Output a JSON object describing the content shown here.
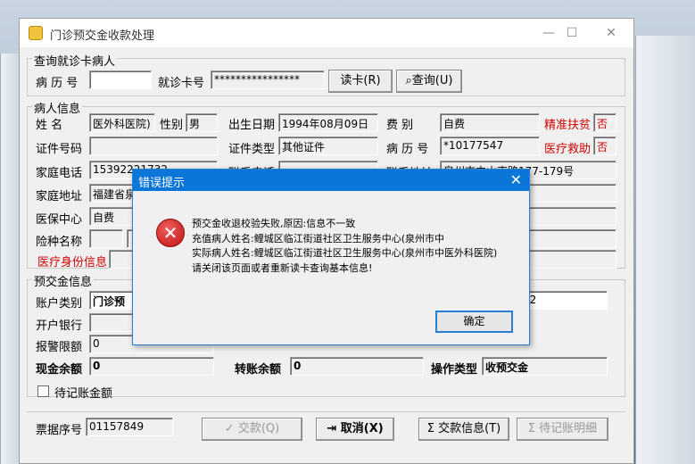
{
  "window": {
    "title": "门诊预交金收款处理"
  },
  "query": {
    "group_label": "查询就诊卡病人",
    "record_label": "病 历 号",
    "record_value": "",
    "card_label": "就诊卡号",
    "card_value": "****************",
    "read_card_button": "读卡(R)",
    "search_button": "查询(U)"
  },
  "patient": {
    "group_label": "病人信息",
    "name_label": "姓    名",
    "name_value": "医外科医院)",
    "sex_label": "性别",
    "sex_value": "男",
    "birth_label": "出生日期",
    "birth_value": "1994年08月09日",
    "fee_label": "费    别",
    "fee_value": "自费",
    "poverty_label": "精准扶贫",
    "poverty_value": "否",
    "id_label": "证件号码",
    "id_value": "",
    "idtype_label": "证件类型",
    "idtype_value": "其他证件",
    "record_label": "病 历 号",
    "record_value": "*10177547",
    "aid_label": "医疗救助",
    "aid_value": "否",
    "phone_label": "家庭电话",
    "phone_value": "15392221732",
    "contact_label": "联系电话",
    "contact_value": "",
    "contact_addr_label": "联系地址",
    "contact_addr_value": "泉州市中山南路177-179号",
    "home_addr_label": "家庭地址",
    "home_addr_value": "福建省泉",
    "insurance_label": "医保中心",
    "insurance_value": "自费",
    "risk_label": "险种名称",
    "medical_id_label": "医疗身份信息"
  },
  "deposit": {
    "group_label": "预交金信息",
    "account_label": "账户类别",
    "account_value": "门诊预",
    "account_extra": "12",
    "bank_label": "开户银行",
    "quota_label": "报警限额",
    "quota_value": "0",
    "cash_label": "现金余额",
    "cash_value": "0",
    "transfer_label": "转账余额",
    "transfer_value": "0",
    "optype_label": "操作类型",
    "optype_value": "收预交金",
    "pending_label": "待记账金额"
  },
  "footer": {
    "receipt_label": "票据序号",
    "receipt_value": "01157849",
    "pay_button": "交款(Q)",
    "cancel_button": "取消(X)",
    "payinfo_button": "交款信息(T)",
    "detail_button": "待记账明细"
  },
  "dialog": {
    "title": "错误提示",
    "line1": "预交金收退校验失败,原因:信息不一致",
    "line2": "充值病人姓名:鲤城区临江街道社区卫生服务中心(泉州市中",
    "line3": "实际病人姓名:鲤城区临江街道社区卫生服务中心(泉州市中医外科医院)",
    "line4": "请关闭该页面或者重新读卡查询基本信息!",
    "ok_button": "确定"
  },
  "colors": {
    "dialog_title": "#0a76d8",
    "warn_label": "#d00000"
  }
}
